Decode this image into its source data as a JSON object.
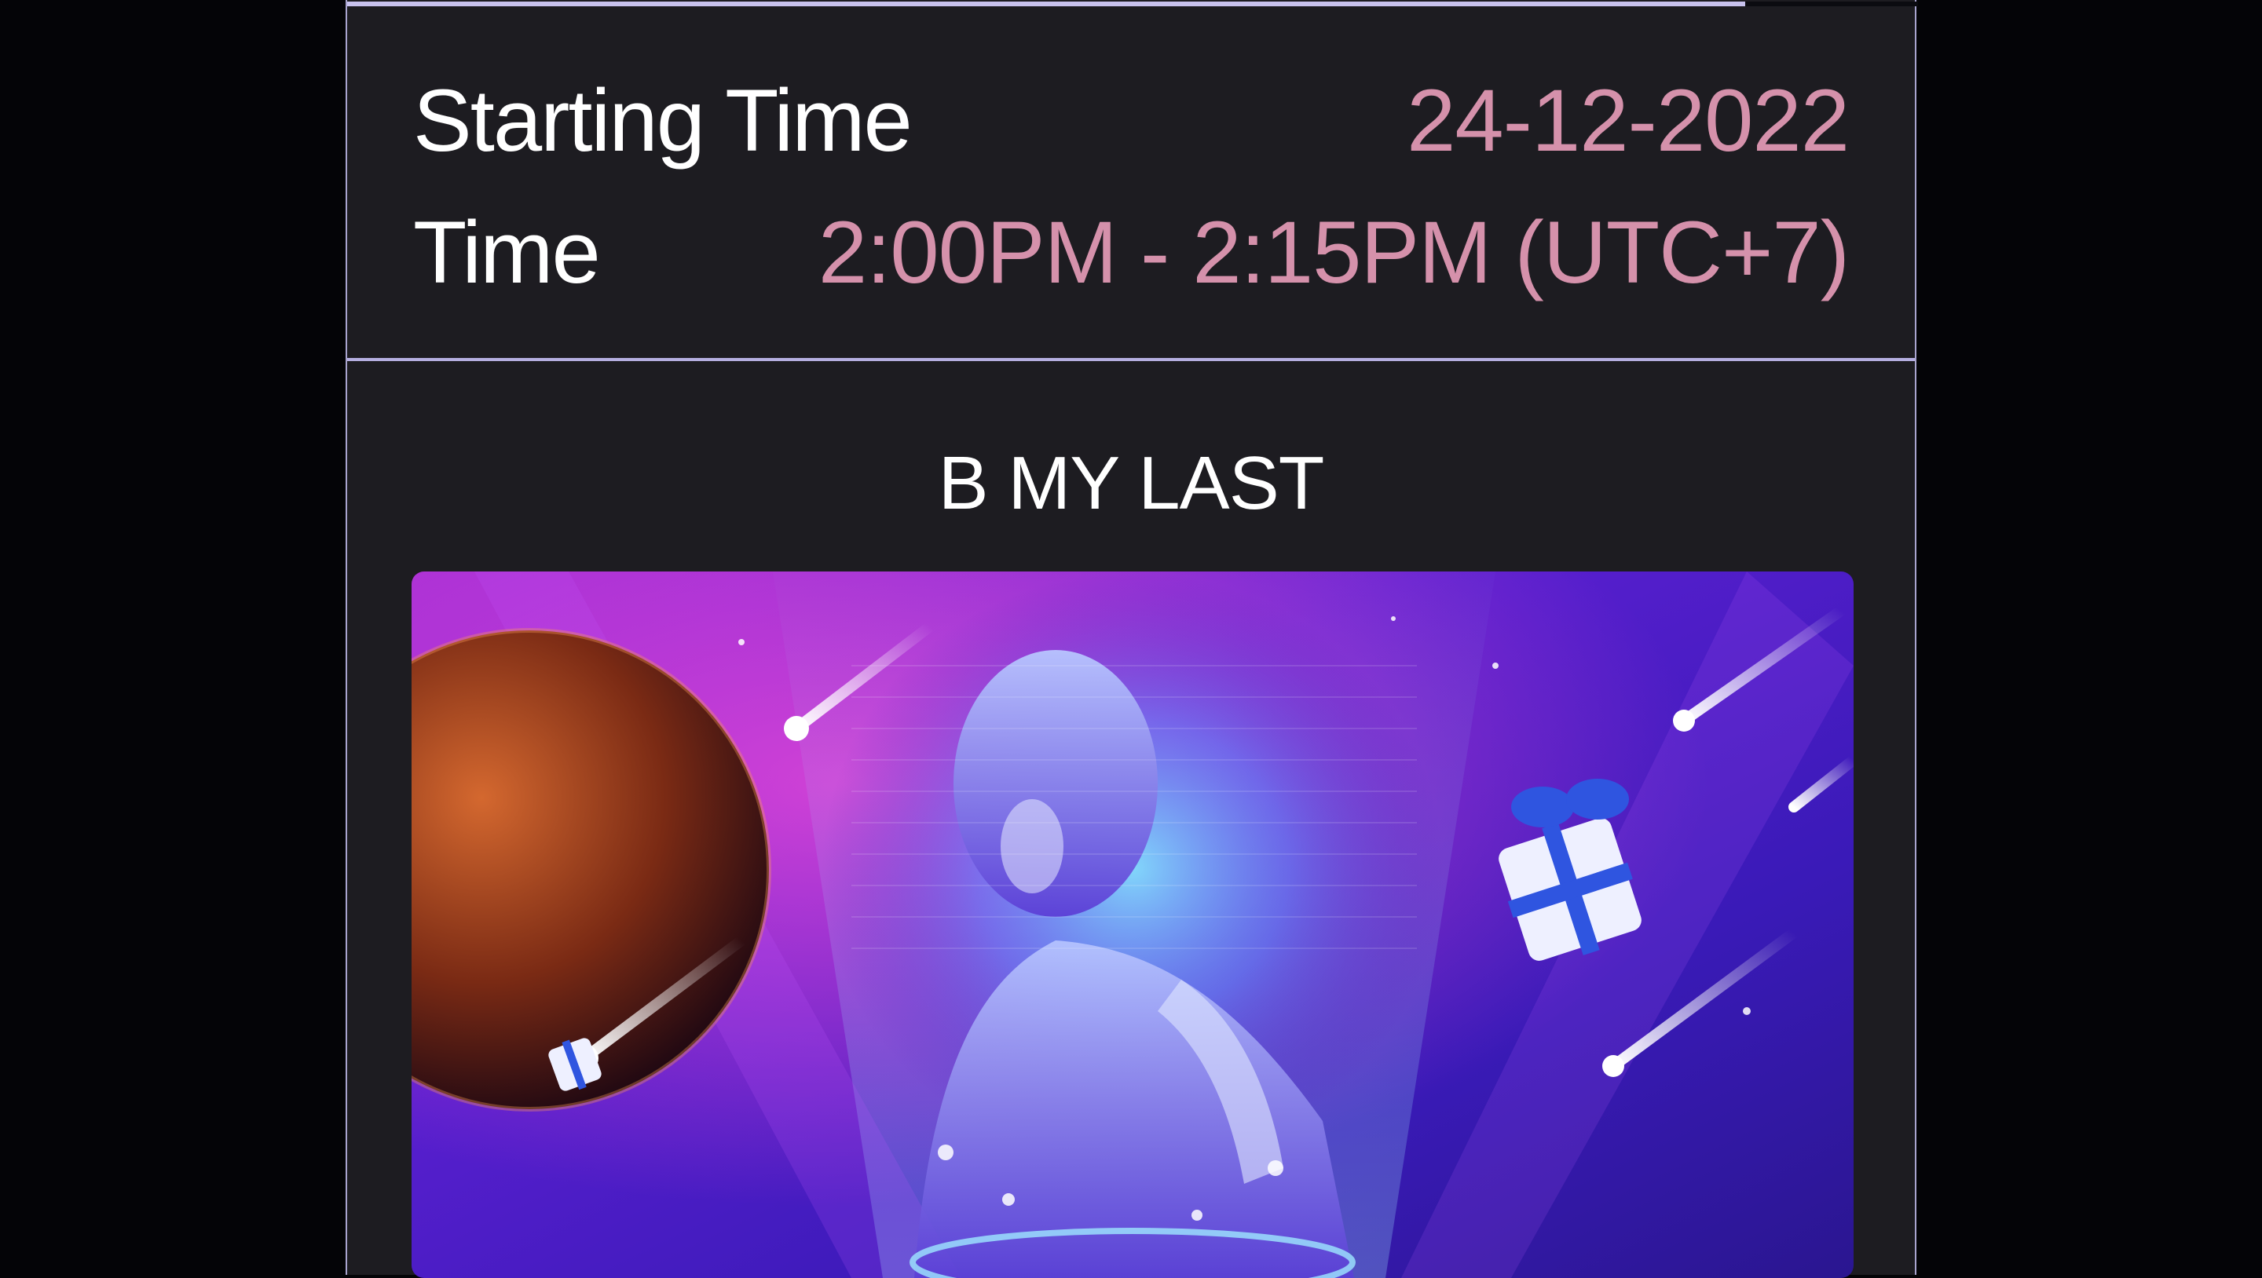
{
  "schedule": {
    "starting_time_label": "Starting Time",
    "starting_time_value": "24-12-2022",
    "time_label": "Time",
    "time_value": "2:00PM - 2:15PM (UTC+7)"
  },
  "progress": {
    "fraction": 0.89
  },
  "event": {
    "title": "B MY LAST",
    "banner_alt": "B MY LAST"
  },
  "colors": {
    "accent_value": "#d591ab",
    "panel_background": "#1d1c21",
    "border": "#a9a4cf"
  }
}
